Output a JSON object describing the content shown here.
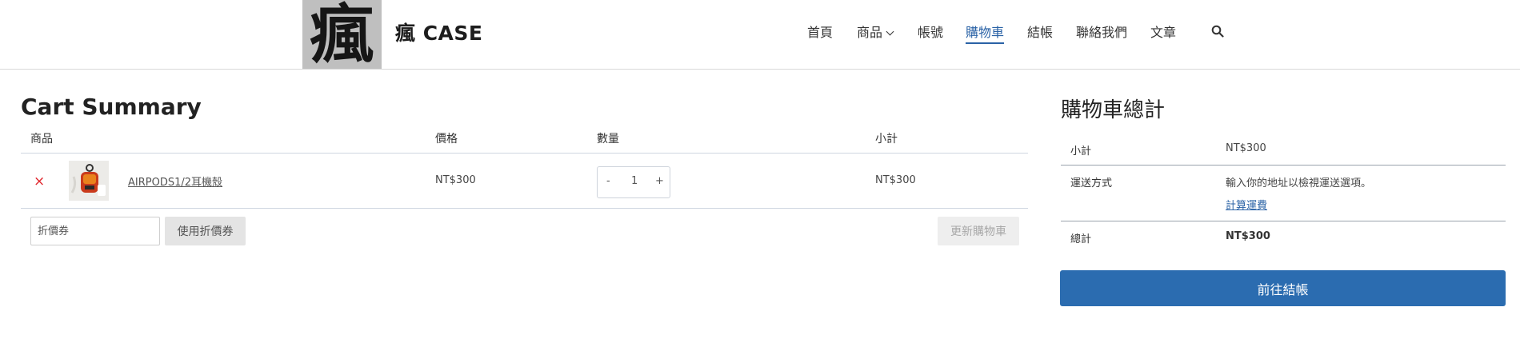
{
  "header": {
    "logo_glyph": "瘋",
    "site_title": "瘋 CASE",
    "nav": [
      {
        "label": "首頁"
      },
      {
        "label": "商品"
      },
      {
        "label": "帳號"
      },
      {
        "label": "購物車"
      },
      {
        "label": "結帳"
      },
      {
        "label": "聯絡我們"
      },
      {
        "label": "文章"
      }
    ],
    "active_nav": "購物車",
    "search_icon": "search-icon"
  },
  "cart": {
    "title": "Cart Summary",
    "columns": {
      "product": "商品",
      "price": "價格",
      "quantity": "數量",
      "subtotal": "小計"
    },
    "items": [
      {
        "remove": "×",
        "name": "AIRPODS1/2耳機殼",
        "price": "NT$300",
        "qty_minus": "-",
        "quantity": "1",
        "qty_plus": "+",
        "subtotal": "NT$300"
      }
    ],
    "coupon_placeholder": "折價券",
    "apply_coupon": "使用折價券",
    "update_cart": "更新購物車"
  },
  "totals": {
    "title": "購物車總計",
    "subtotal_label": "小計",
    "subtotal_value": "NT$300",
    "shipping_label": "運送方式",
    "shipping_note": "輸入你的地址以檢視運送選項。",
    "shipping_link": "計算運費",
    "total_label": "總計",
    "total_value": "NT$300",
    "checkout": "前往結帳"
  },
  "colors": {
    "accent": "#2a62a6",
    "checkout_button": "#2b6cb0",
    "remove": "#e0242b"
  }
}
